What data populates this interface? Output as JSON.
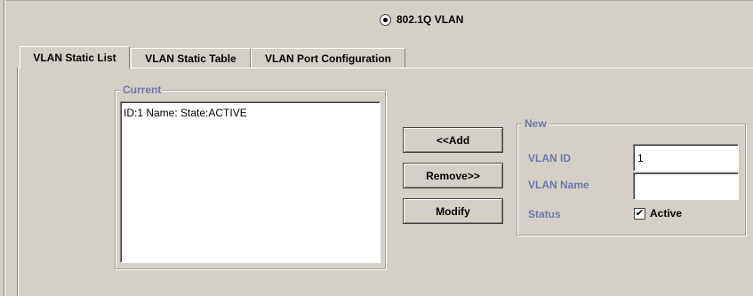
{
  "mode": {
    "label": "802.1Q VLAN",
    "selected": true
  },
  "tabs": [
    {
      "label": "VLAN Static List",
      "active": true
    },
    {
      "label": "VLAN Static Table",
      "active": false
    },
    {
      "label": "VLAN Port Configuration",
      "active": false
    }
  ],
  "current": {
    "title": "Current",
    "items": [
      "ID:1  Name:  State:ACTIVE"
    ]
  },
  "buttons": {
    "add": "<<Add",
    "remove": "Remove>>",
    "modify": "Modify"
  },
  "new": {
    "title": "New",
    "vlan_id_label": "VLAN ID",
    "vlan_id_value": "1",
    "vlan_name_label": "VLAN Name",
    "vlan_name_value": "",
    "status_label": "Status",
    "active_label": "Active",
    "active_checked": true,
    "check_glyph": "✔"
  },
  "colors": {
    "background": "#d4d0c8",
    "groupbox_title": "#6f77a8"
  }
}
